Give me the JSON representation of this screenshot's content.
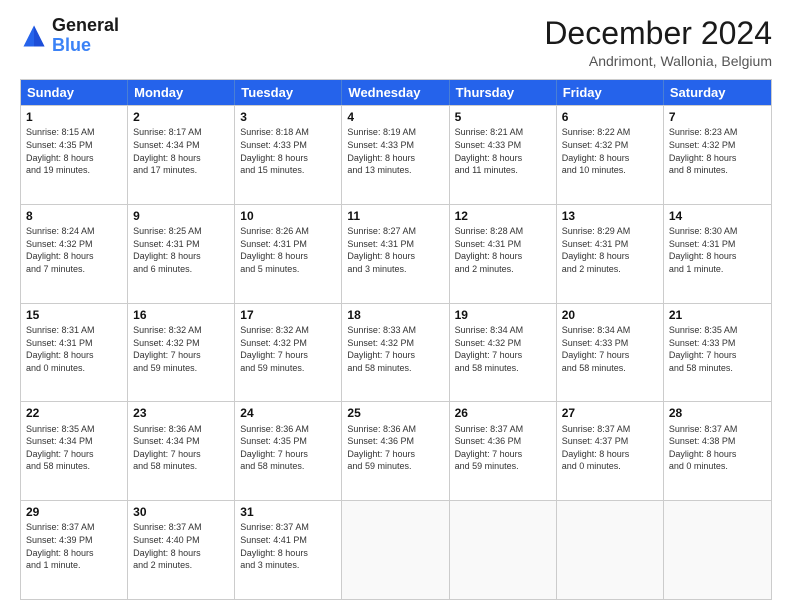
{
  "logo": {
    "line1": "General",
    "line2": "Blue"
  },
  "header": {
    "month": "December 2024",
    "location": "Andrimont, Wallonia, Belgium"
  },
  "weekdays": [
    "Sunday",
    "Monday",
    "Tuesday",
    "Wednesday",
    "Thursday",
    "Friday",
    "Saturday"
  ],
  "rows": [
    [
      {
        "day": "1",
        "lines": [
          "Sunrise: 8:15 AM",
          "Sunset: 4:35 PM",
          "Daylight: 8 hours",
          "and 19 minutes."
        ]
      },
      {
        "day": "2",
        "lines": [
          "Sunrise: 8:17 AM",
          "Sunset: 4:34 PM",
          "Daylight: 8 hours",
          "and 17 minutes."
        ]
      },
      {
        "day": "3",
        "lines": [
          "Sunrise: 8:18 AM",
          "Sunset: 4:33 PM",
          "Daylight: 8 hours",
          "and 15 minutes."
        ]
      },
      {
        "day": "4",
        "lines": [
          "Sunrise: 8:19 AM",
          "Sunset: 4:33 PM",
          "Daylight: 8 hours",
          "and 13 minutes."
        ]
      },
      {
        "day": "5",
        "lines": [
          "Sunrise: 8:21 AM",
          "Sunset: 4:33 PM",
          "Daylight: 8 hours",
          "and 11 minutes."
        ]
      },
      {
        "day": "6",
        "lines": [
          "Sunrise: 8:22 AM",
          "Sunset: 4:32 PM",
          "Daylight: 8 hours",
          "and 10 minutes."
        ]
      },
      {
        "day": "7",
        "lines": [
          "Sunrise: 8:23 AM",
          "Sunset: 4:32 PM",
          "Daylight: 8 hours",
          "and 8 minutes."
        ]
      }
    ],
    [
      {
        "day": "8",
        "lines": [
          "Sunrise: 8:24 AM",
          "Sunset: 4:32 PM",
          "Daylight: 8 hours",
          "and 7 minutes."
        ]
      },
      {
        "day": "9",
        "lines": [
          "Sunrise: 8:25 AM",
          "Sunset: 4:31 PM",
          "Daylight: 8 hours",
          "and 6 minutes."
        ]
      },
      {
        "day": "10",
        "lines": [
          "Sunrise: 8:26 AM",
          "Sunset: 4:31 PM",
          "Daylight: 8 hours",
          "and 5 minutes."
        ]
      },
      {
        "day": "11",
        "lines": [
          "Sunrise: 8:27 AM",
          "Sunset: 4:31 PM",
          "Daylight: 8 hours",
          "and 3 minutes."
        ]
      },
      {
        "day": "12",
        "lines": [
          "Sunrise: 8:28 AM",
          "Sunset: 4:31 PM",
          "Daylight: 8 hours",
          "and 2 minutes."
        ]
      },
      {
        "day": "13",
        "lines": [
          "Sunrise: 8:29 AM",
          "Sunset: 4:31 PM",
          "Daylight: 8 hours",
          "and 2 minutes."
        ]
      },
      {
        "day": "14",
        "lines": [
          "Sunrise: 8:30 AM",
          "Sunset: 4:31 PM",
          "Daylight: 8 hours",
          "and 1 minute."
        ]
      }
    ],
    [
      {
        "day": "15",
        "lines": [
          "Sunrise: 8:31 AM",
          "Sunset: 4:31 PM",
          "Daylight: 8 hours",
          "and 0 minutes."
        ]
      },
      {
        "day": "16",
        "lines": [
          "Sunrise: 8:32 AM",
          "Sunset: 4:32 PM",
          "Daylight: 7 hours",
          "and 59 minutes."
        ]
      },
      {
        "day": "17",
        "lines": [
          "Sunrise: 8:32 AM",
          "Sunset: 4:32 PM",
          "Daylight: 7 hours",
          "and 59 minutes."
        ]
      },
      {
        "day": "18",
        "lines": [
          "Sunrise: 8:33 AM",
          "Sunset: 4:32 PM",
          "Daylight: 7 hours",
          "and 58 minutes."
        ]
      },
      {
        "day": "19",
        "lines": [
          "Sunrise: 8:34 AM",
          "Sunset: 4:32 PM",
          "Daylight: 7 hours",
          "and 58 minutes."
        ]
      },
      {
        "day": "20",
        "lines": [
          "Sunrise: 8:34 AM",
          "Sunset: 4:33 PM",
          "Daylight: 7 hours",
          "and 58 minutes."
        ]
      },
      {
        "day": "21",
        "lines": [
          "Sunrise: 8:35 AM",
          "Sunset: 4:33 PM",
          "Daylight: 7 hours",
          "and 58 minutes."
        ]
      }
    ],
    [
      {
        "day": "22",
        "lines": [
          "Sunrise: 8:35 AM",
          "Sunset: 4:34 PM",
          "Daylight: 7 hours",
          "and 58 minutes."
        ]
      },
      {
        "day": "23",
        "lines": [
          "Sunrise: 8:36 AM",
          "Sunset: 4:34 PM",
          "Daylight: 7 hours",
          "and 58 minutes."
        ]
      },
      {
        "day": "24",
        "lines": [
          "Sunrise: 8:36 AM",
          "Sunset: 4:35 PM",
          "Daylight: 7 hours",
          "and 58 minutes."
        ]
      },
      {
        "day": "25",
        "lines": [
          "Sunrise: 8:36 AM",
          "Sunset: 4:36 PM",
          "Daylight: 7 hours",
          "and 59 minutes."
        ]
      },
      {
        "day": "26",
        "lines": [
          "Sunrise: 8:37 AM",
          "Sunset: 4:36 PM",
          "Daylight: 7 hours",
          "and 59 minutes."
        ]
      },
      {
        "day": "27",
        "lines": [
          "Sunrise: 8:37 AM",
          "Sunset: 4:37 PM",
          "Daylight: 8 hours",
          "and 0 minutes."
        ]
      },
      {
        "day": "28",
        "lines": [
          "Sunrise: 8:37 AM",
          "Sunset: 4:38 PM",
          "Daylight: 8 hours",
          "and 0 minutes."
        ]
      }
    ],
    [
      {
        "day": "29",
        "lines": [
          "Sunrise: 8:37 AM",
          "Sunset: 4:39 PM",
          "Daylight: 8 hours",
          "and 1 minute."
        ]
      },
      {
        "day": "30",
        "lines": [
          "Sunrise: 8:37 AM",
          "Sunset: 4:40 PM",
          "Daylight: 8 hours",
          "and 2 minutes."
        ]
      },
      {
        "day": "31",
        "lines": [
          "Sunrise: 8:37 AM",
          "Sunset: 4:41 PM",
          "Daylight: 8 hours",
          "and 3 minutes."
        ]
      },
      {
        "day": "",
        "lines": []
      },
      {
        "day": "",
        "lines": []
      },
      {
        "day": "",
        "lines": []
      },
      {
        "day": "",
        "lines": []
      }
    ]
  ]
}
